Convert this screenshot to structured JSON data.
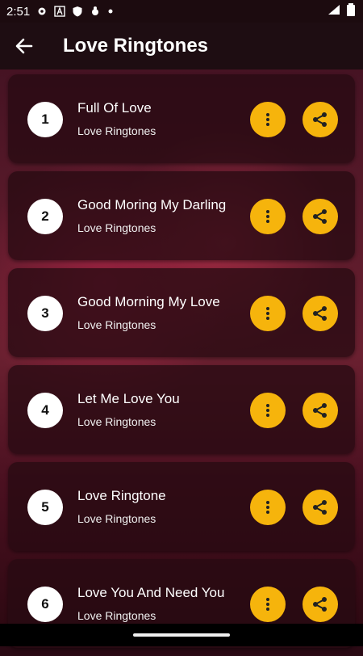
{
  "status_bar": {
    "time": "2:51",
    "icons": [
      "gear-icon",
      "font-a-icon",
      "shield-icon",
      "bug-icon",
      "dot-icon"
    ],
    "right_icons": [
      "wifi-icon",
      "battery-icon"
    ]
  },
  "app_bar": {
    "back_icon": "arrow-left-icon",
    "title": "Love Ringtones"
  },
  "ringtones": [
    {
      "number": "1",
      "title": "Full Of Love",
      "subtitle": "Love Ringtones"
    },
    {
      "number": "2",
      "title": "Good Moring My Darling",
      "subtitle": "Love Ringtones"
    },
    {
      "number": "3",
      "title": "Good Morning My Love",
      "subtitle": "Love Ringtones"
    },
    {
      "number": "4",
      "title": "Let Me Love You",
      "subtitle": "Love Ringtones"
    },
    {
      "number": "5",
      "title": "Love Ringtone",
      "subtitle": "Love Ringtones"
    },
    {
      "number": "6",
      "title": "Love You And Need You",
      "subtitle": "Love Ringtones"
    }
  ],
  "colors": {
    "accent": "#f6b40c",
    "appbar": "#1e0d12",
    "card": "#280a12"
  }
}
